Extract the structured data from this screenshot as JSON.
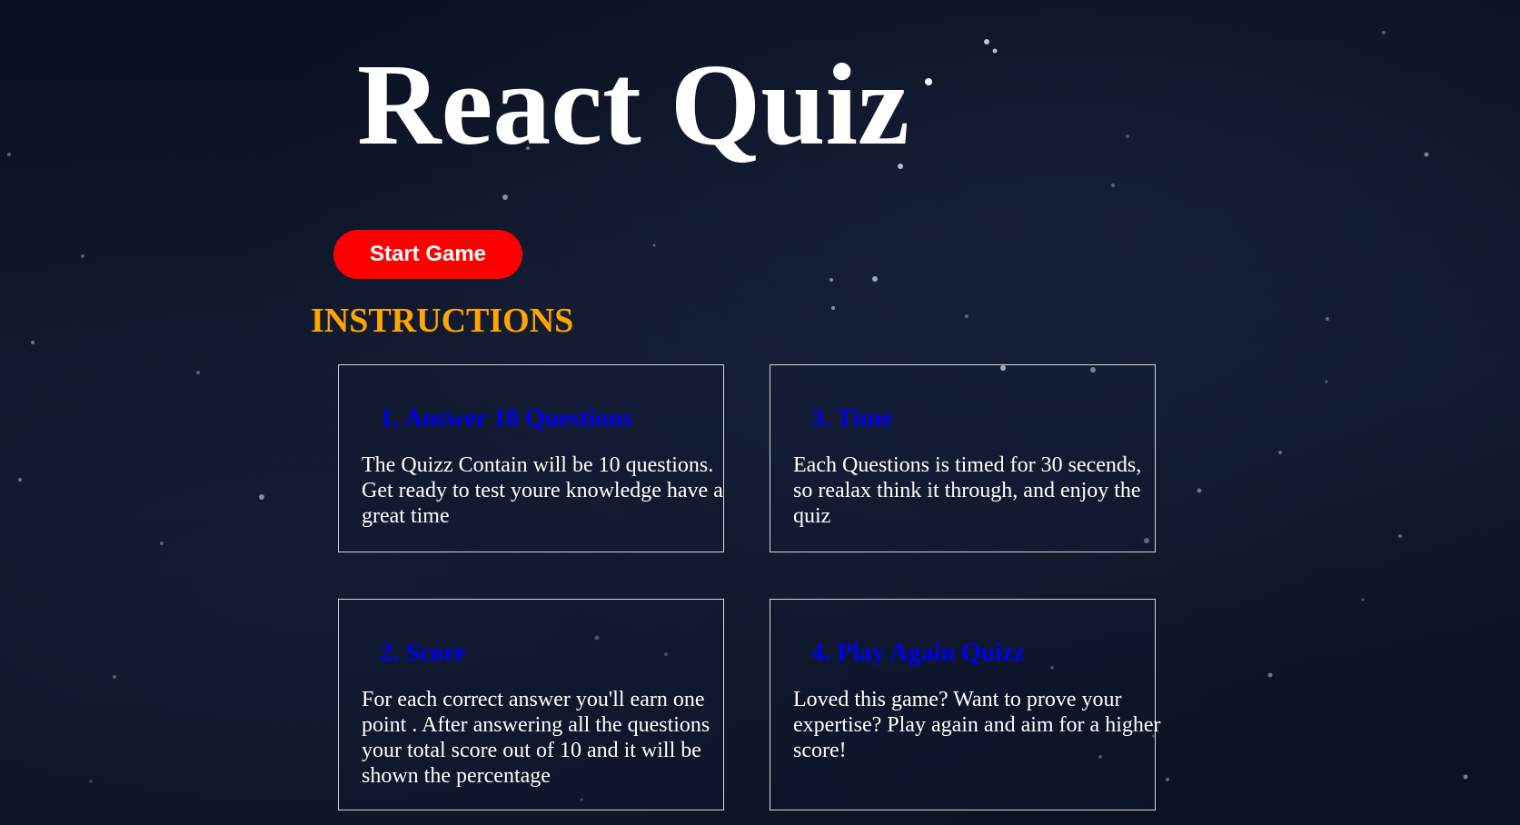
{
  "page": {
    "title": "React Quiz",
    "start_button_label": "Start Game",
    "instructions_heading": "INSTRUCTIONS"
  },
  "instructions": [
    {
      "title": "1. Answer 10 Questions",
      "text": "The Quizz Contain will be 10 questions. Get ready to test youre knowledge have a great time"
    },
    {
      "title": "3. Time",
      "text": "Each Questions is timed for 30 secends, so realax think it through, and enjoy the quiz"
    },
    {
      "title": "2. Score",
      "text": "For each correct answer you'll earn one point . After answering all the questions your total score out of 10 and it will be shown the percentage"
    },
    {
      "title": "4. Play Again Quizz",
      "text": "Loved this game? Want to prove your expertise? Play again and aim for a higher score!"
    }
  ],
  "colors": {
    "background": "#0e1628",
    "title": "#ffffff",
    "start_button": "#ff0000",
    "instructions_heading": "#ffa500",
    "card_title": "#0000ee",
    "card_text": "#ffffff",
    "card_border": "#d8d8d8"
  }
}
